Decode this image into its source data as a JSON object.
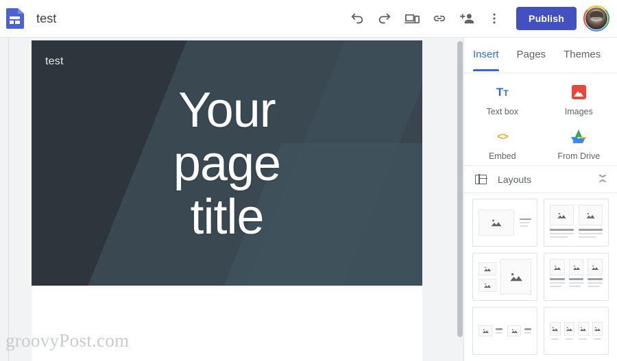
{
  "app": {
    "logo_icon": "google-sites-icon",
    "doc_title": "test"
  },
  "toolbar": {
    "undo_icon": "undo-icon",
    "redo_icon": "redo-icon",
    "preview_icon": "preview-devices-icon",
    "link_icon": "copy-link-icon",
    "share_icon": "add-person-icon",
    "more_icon": "more-vertical-icon",
    "publish_label": "Publish",
    "avatar_icon": "account-avatar"
  },
  "canvas": {
    "site_name": "test",
    "page_title": "Your page title",
    "watermark": "groovyPost.com",
    "banner_colors": {
      "base": "#37474f",
      "band_dark": "#2e353c",
      "band_mid": "#394851",
      "band_light": "#3f525c"
    }
  },
  "panel": {
    "tabs": [
      {
        "label": "Insert",
        "active": true
      },
      {
        "label": "Pages",
        "active": false
      },
      {
        "label": "Themes",
        "active": false
      }
    ],
    "insert_items": [
      {
        "label": "Text box",
        "icon": "text-box-icon"
      },
      {
        "label": "Images",
        "icon": "images-icon"
      },
      {
        "label": "Embed",
        "icon": "embed-code-icon"
      },
      {
        "label": "From Drive",
        "icon": "google-drive-icon"
      }
    ],
    "layouts": {
      "title": "Layouts",
      "icon": "layout-grid-icon",
      "collapse_icon": "collapse-chevrons-icon",
      "options": [
        {
          "name": "image-left-text-right"
        },
        {
          "name": "two-images-with-captions"
        },
        {
          "name": "two-small-images-one-large"
        },
        {
          "name": "three-columns-image-text"
        },
        {
          "name": "two-pairs-image-text"
        },
        {
          "name": "four-images-row"
        }
      ]
    }
  },
  "colors": {
    "accent_blue": "#3367d6",
    "publish_blue": "#4350c0",
    "text_gray": "#5f6368",
    "panel_bg": "#ffffff",
    "editor_bg": "#f1f3f4"
  }
}
